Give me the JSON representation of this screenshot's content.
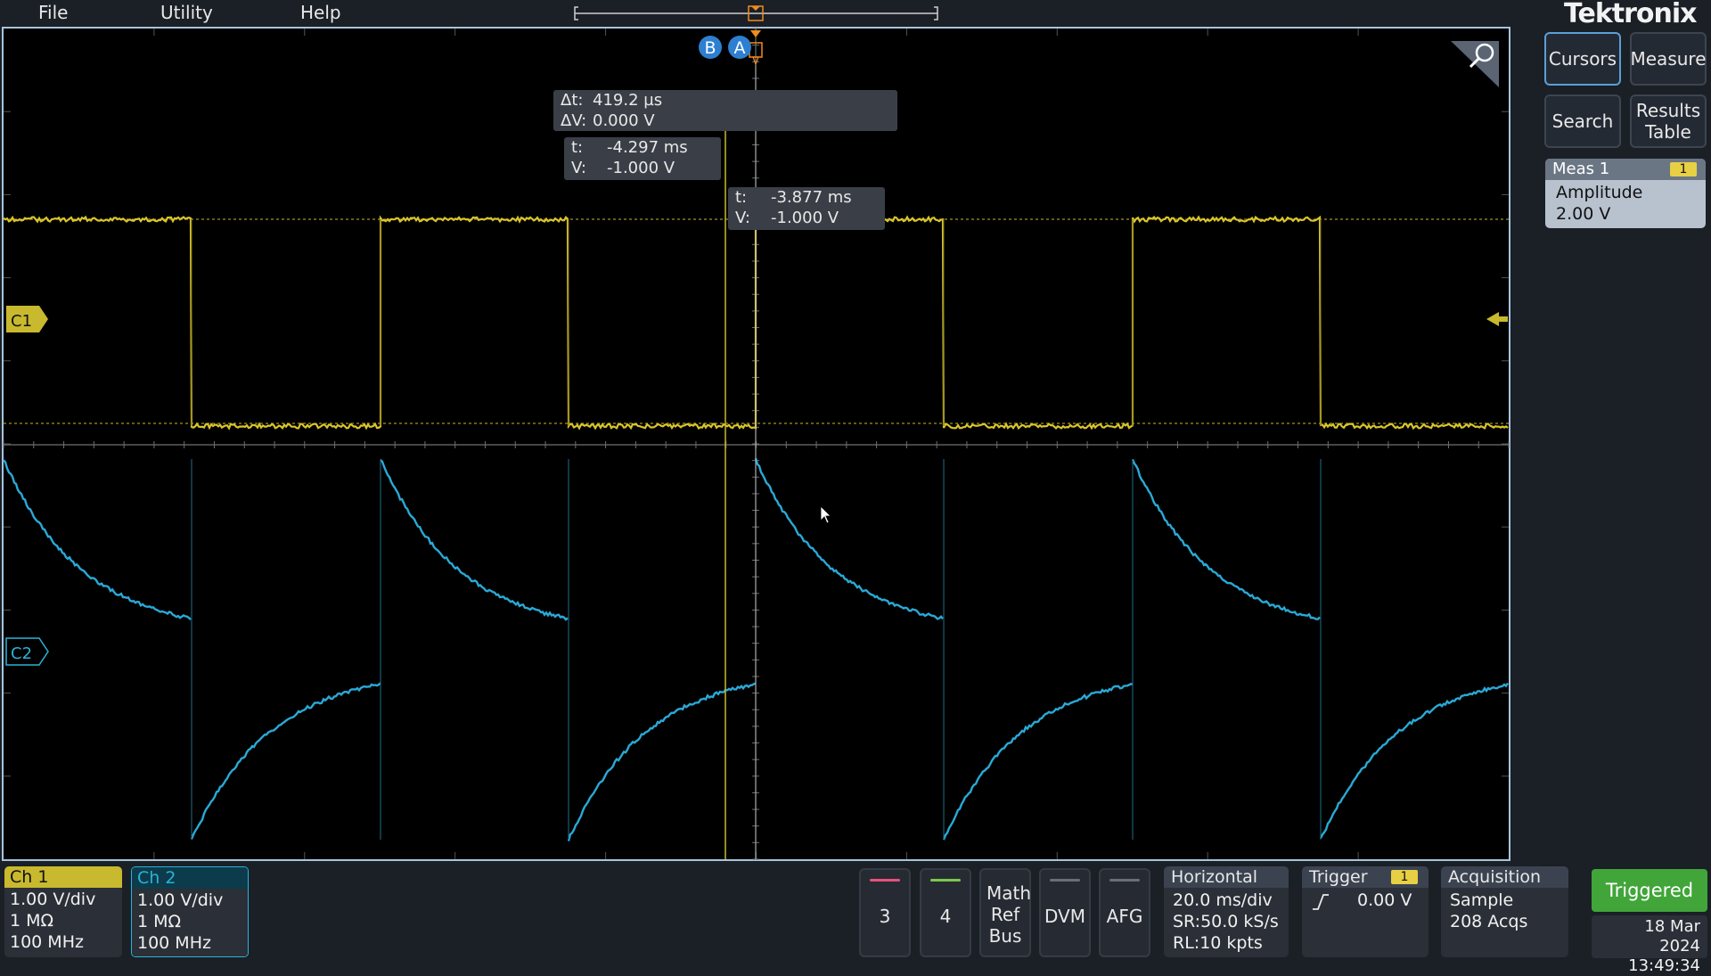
{
  "menu": {
    "file": "File",
    "utility": "Utility",
    "help": "Help"
  },
  "brand": "Tektronix",
  "cursors": {
    "a_label": "A",
    "b_label": "B",
    "delta_t": "Δt:",
    "delta_t_value": "419.2 µs",
    "delta_v": "ΔV:",
    "delta_v_value": "0.000 V",
    "cursor_b": {
      "t_key": "t:",
      "t": "-4.297 ms",
      "v_key": "V:",
      "v": "-1.000 V"
    },
    "cursor_a": {
      "t_key": "t:",
      "t": "-3.877 ms",
      "v_key": "V:",
      "v": "-1.000 V"
    }
  },
  "channel_markers": {
    "c1": "C1",
    "c2": "C2"
  },
  "right_panel": {
    "cursors": "Cursors",
    "measure": "Measure",
    "search": "Search",
    "results_table": "Results Table",
    "meas1": {
      "title": "Meas 1",
      "badge": "1",
      "name": "Amplitude",
      "value": "2.00 V"
    }
  },
  "ch1": {
    "title": "Ch 1",
    "scale": "1.00 V/div",
    "impedance": "1 MΩ",
    "bandwidth": "100 MHz",
    "color": "#c8b92e"
  },
  "ch2": {
    "title": "Ch 2",
    "scale": "1.00 V/div",
    "impedance": "1 MΩ",
    "bandwidth": "100 MHz",
    "color": "#2bb2d8"
  },
  "buttons": {
    "ch3": "3",
    "ch4": "4",
    "math_ref_bus": "Math Ref Bus",
    "dvm": "DVM",
    "afg": "AFG"
  },
  "horizontal": {
    "title": "Horizontal",
    "scale": "20.0 ms/div",
    "sr": "SR:50.0 kS/s",
    "rl": "RL:10 kpts"
  },
  "trigger": {
    "title": "Trigger",
    "badge": "1",
    "level": "0.00 V"
  },
  "acquisition": {
    "title": "Acquisition",
    "mode": "Sample",
    "count": "208 Acqs"
  },
  "status": {
    "triggered": "Triggered",
    "date": "18 Mar 2024",
    "time": "13:49:34"
  },
  "colors": {
    "ch1": "#d9c52a",
    "ch2": "#2aa9d6",
    "cursor": "#c8b92e",
    "trigger": "#f08c1e",
    "triggered": "#41a53a"
  }
}
